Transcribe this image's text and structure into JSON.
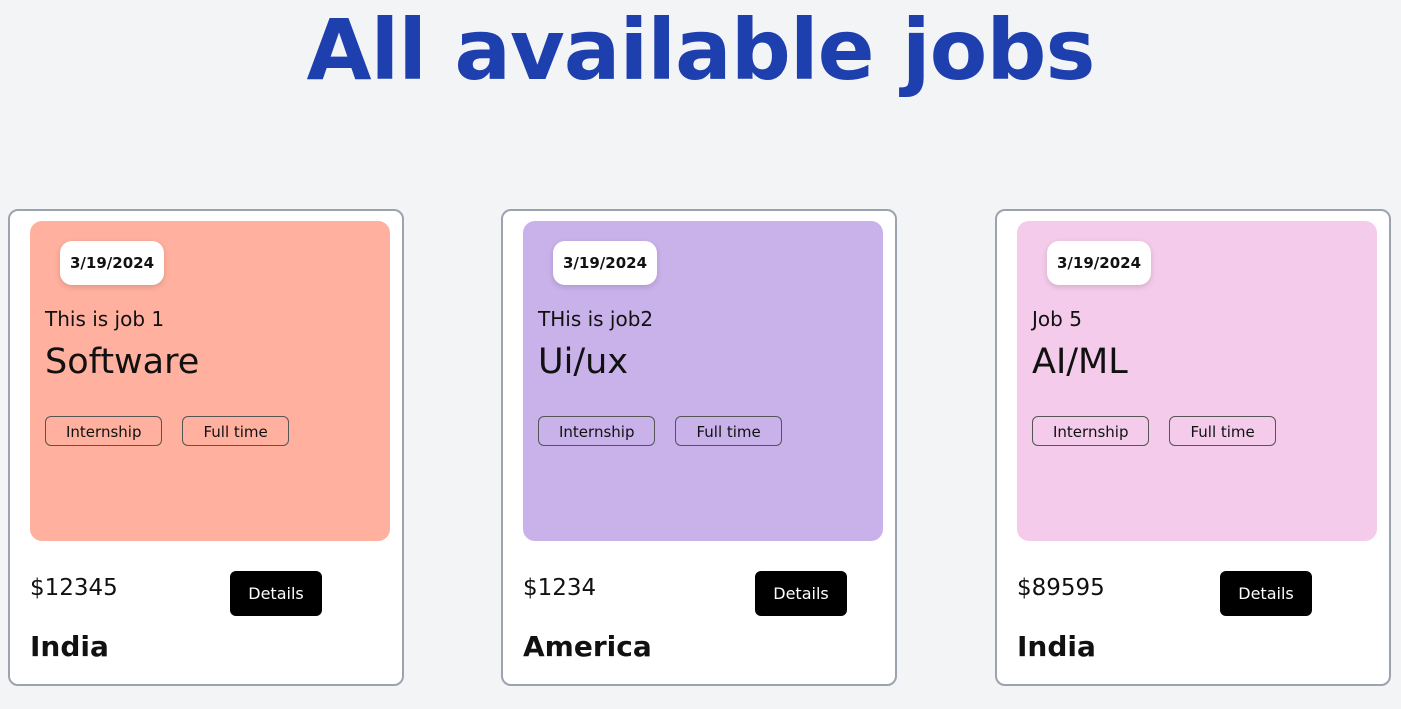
{
  "page": {
    "title": "All available jobs"
  },
  "jobs": [
    {
      "date": "3/19/2024",
      "subtitle": "This is job 1",
      "title": "Software",
      "tags": [
        "Internship",
        "Full time"
      ],
      "salary": "$12345",
      "location": "India",
      "details_label": "Details",
      "panel_color": "#ffb09e"
    },
    {
      "date": "3/19/2024",
      "subtitle": "THis is job2",
      "title": "Ui/ux",
      "tags": [
        "Internship",
        "Full time"
      ],
      "salary": "$1234",
      "location": "America",
      "details_label": "Details",
      "panel_color": "#c9b1ea"
    },
    {
      "date": "3/19/2024",
      "subtitle": "Job 5",
      "title": "AI/ML",
      "tags": [
        "Internship",
        "Full time"
      ],
      "salary": "$89595",
      "location": "India",
      "details_label": "Details",
      "panel_color": "#f4cbea"
    }
  ],
  "colors": {
    "title": "#1e40af",
    "background": "#f3f4f6",
    "button": "#000000"
  }
}
